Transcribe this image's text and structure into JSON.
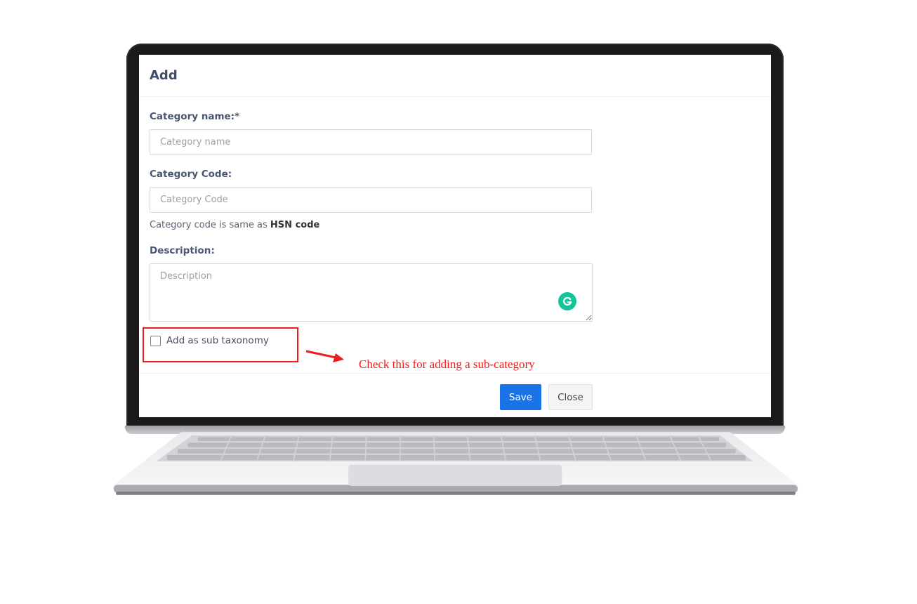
{
  "modal": {
    "title": "Add",
    "category_name": {
      "label": "Category name:*",
      "placeholder": "Category name",
      "value": ""
    },
    "category_code": {
      "label": "Category Code:",
      "placeholder": "Category Code",
      "value": "",
      "help_prefix": "Category code is same as ",
      "help_bold": "HSN code"
    },
    "description": {
      "label": "Description:",
      "placeholder": "Description",
      "value": ""
    },
    "sub_taxonomy": {
      "label": "Add as sub taxonomy",
      "checked": false
    },
    "buttons": {
      "save": "Save",
      "close": "Close"
    }
  },
  "annotation": {
    "text": "Check this for adding a sub-category",
    "color": "#ee1c1c"
  },
  "icons": {
    "grammarly": "grammarly-icon"
  },
  "colors": {
    "primary": "#1b73e8",
    "highlight": "#ee1c1c",
    "grammarly": "#15c39a"
  }
}
